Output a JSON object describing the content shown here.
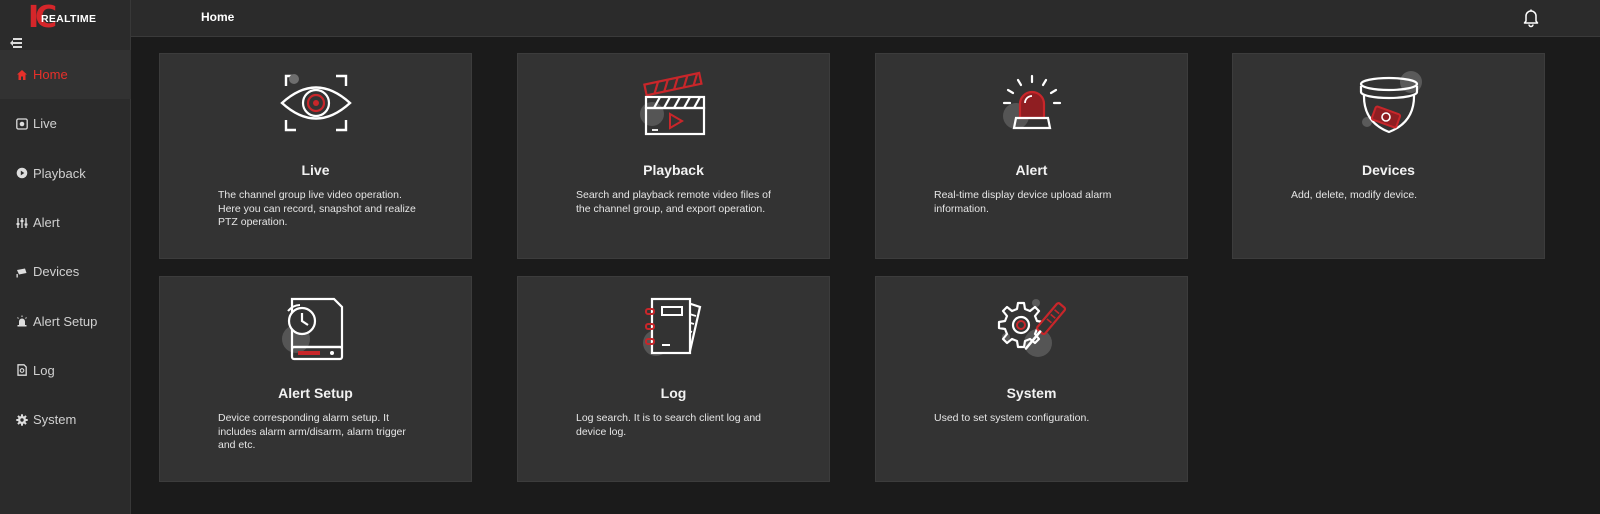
{
  "logo": {
    "mark": "IC",
    "text": "REALTIME"
  },
  "header": {
    "title": "Home"
  },
  "sidebar": {
    "items": [
      {
        "label": "Home",
        "icon": "home-icon",
        "active": true
      },
      {
        "label": "Live",
        "icon": "live-icon"
      },
      {
        "label": "Playback",
        "icon": "playback-icon"
      },
      {
        "label": "Alert",
        "icon": "alert-icon"
      },
      {
        "label": "Devices",
        "icon": "devices-icon"
      },
      {
        "label": "Alert Setup",
        "icon": "alert-setup-icon"
      },
      {
        "label": "Log",
        "icon": "log-icon"
      },
      {
        "label": "System",
        "icon": "system-icon"
      }
    ]
  },
  "cards": [
    {
      "title": "Live",
      "icon": "eye-icon",
      "desc": "The channel group live video operation. Here you can record, snapshot and realize PTZ operation."
    },
    {
      "title": "Playback",
      "icon": "clapperboard-icon",
      "desc": "Search and playback remote video files of the channel group, and export operation."
    },
    {
      "title": "Alert",
      "icon": "siren-icon",
      "desc": "Real-time display device upload alarm information."
    },
    {
      "title": "Devices",
      "icon": "dome-camera-icon",
      "desc": "Add, delete, modify device."
    },
    {
      "title": "Alert Setup",
      "icon": "clock-dvr-icon",
      "desc": "Device corresponding alarm setup. It includes alarm arm/disarm, alarm trigger and etc."
    },
    {
      "title": "Log",
      "icon": "notebook-icon",
      "desc": "Log search. It is to search client log and device log."
    },
    {
      "title": "System",
      "icon": "gear-wrench-icon",
      "desc": "Used to set system configuration."
    }
  ],
  "colors": {
    "accent": "#e8302a",
    "brand_red": "#d5262a",
    "card_bg": "#333333",
    "page_bg": "#1b1b1b",
    "sidebar_bg": "#2b2b2b"
  }
}
